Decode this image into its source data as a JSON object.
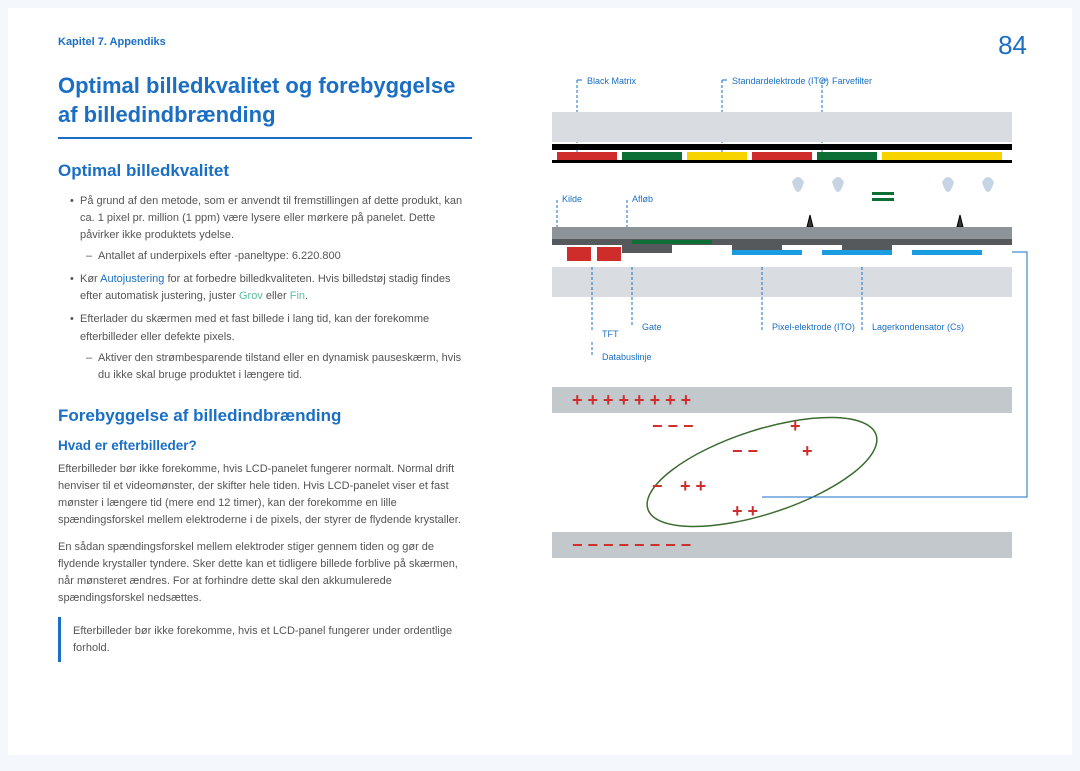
{
  "breadcrumb": "Kapitel 7. Appendiks",
  "page_number": "84",
  "title": "Optimal billedkvalitet og forebyggelse af billedindbrænding",
  "s1": {
    "heading": "Optimal billedkvalitet",
    "b1": "På grund af den metode, som er anvendt til fremstillingen af dette produkt, kan ca. 1 pixel pr. million (1 ppm) være lysere eller mørkere på panelet. Dette påvirker ikke produktets ydelse.",
    "b1s1": "Antallet af underpixels efter -paneltype: 6.220.800",
    "b2a": "Kør ",
    "b2link": "Autojustering",
    "b2b": " for at forbedre billedkvaliteten. Hvis billedstøj stadig findes efter automatisk justering, juster ",
    "b2grov": "Grov",
    "b2or": " eller ",
    "b2fin": "Fin",
    "b2c": ".",
    "b3": "Efterlader du skærmen med et fast billede i lang tid, kan der forekomme efterbilleder eller defekte pixels.",
    "b3s1": "Aktiver den strømbesparende tilstand eller en dynamisk pauseskærm, hvis du ikke skal bruge produktet i længere tid."
  },
  "s2": {
    "heading": "Forebyggelse af billedindbrænding",
    "sub": "Hvad er efterbilleder?",
    "p1": "Efterbilleder bør ikke forekomme, hvis LCD-panelet fungerer normalt. Normal drift henviser til et videomønster, der skifter hele tiden. Hvis LCD-panelet viser et fast mønster i længere tid (mere end 12 timer), kan der forekomme en lille spændingsforskel mellem elektroderne i de pixels, der styrer de flydende krystaller.",
    "p2": "En sådan spændingsforskel mellem elektroder stiger gennem tiden og gør de flydende krystaller tyndere. Sker dette kan et tidligere billede forblive på skærmen, når mønsteret ændres. For at forhindre dette skal den akkumulerede spændingsforskel nedsættes.",
    "note": "Efterbilleder bør ikke forekomme, hvis et LCD-panel fungerer under ordentlige forhold."
  },
  "diagram": {
    "l_blackmatrix": "Black Matrix",
    "l_standard": "Standardelektrode (ITO)",
    "l_color": "Farvefilter",
    "l_source": "Kilde",
    "l_drain": "Afløb",
    "l_tft": "TFT",
    "l_gate": "Gate",
    "l_databus": "Databuslinje",
    "l_pixel": "Pixel-elektrode (ITO)",
    "l_storage": "Lagerkondensator (Cs)"
  }
}
